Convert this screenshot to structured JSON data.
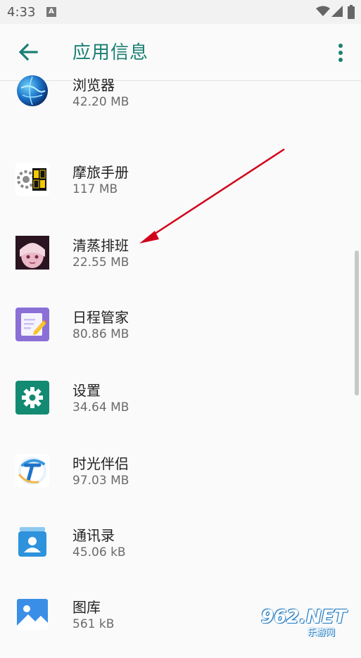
{
  "status_bar": {
    "time": "4:33",
    "notification_letter": "A"
  },
  "app_bar": {
    "title": "应用信息"
  },
  "apps": [
    {
      "name": "浏览器",
      "size": "42.20 MB",
      "icon": "browser-globe-icon"
    },
    {
      "name": "摩旅手册",
      "size": "117 MB",
      "icon": "motorcycle-handbook-icon"
    },
    {
      "name": "清蒸排班",
      "size": "22.55 MB",
      "icon": "anime-avatar-icon"
    },
    {
      "name": "日程管家",
      "size": "80.86 MB",
      "icon": "schedule-notepad-icon"
    },
    {
      "name": "设置",
      "size": "34.64 MB",
      "icon": "settings-gear-icon"
    },
    {
      "name": "时光伴侣",
      "size": "97.03 MB",
      "icon": "time-companion-icon"
    },
    {
      "name": "通讯录",
      "size": "45.06 kB",
      "icon": "contacts-icon"
    },
    {
      "name": "图库",
      "size": "561 kB",
      "icon": "gallery-icon"
    }
  ],
  "watermark": {
    "big": "962.NET",
    "small": "乐游网"
  },
  "colors": {
    "accent": "#1a7f73",
    "annotation_arrow": "#d0021b"
  }
}
